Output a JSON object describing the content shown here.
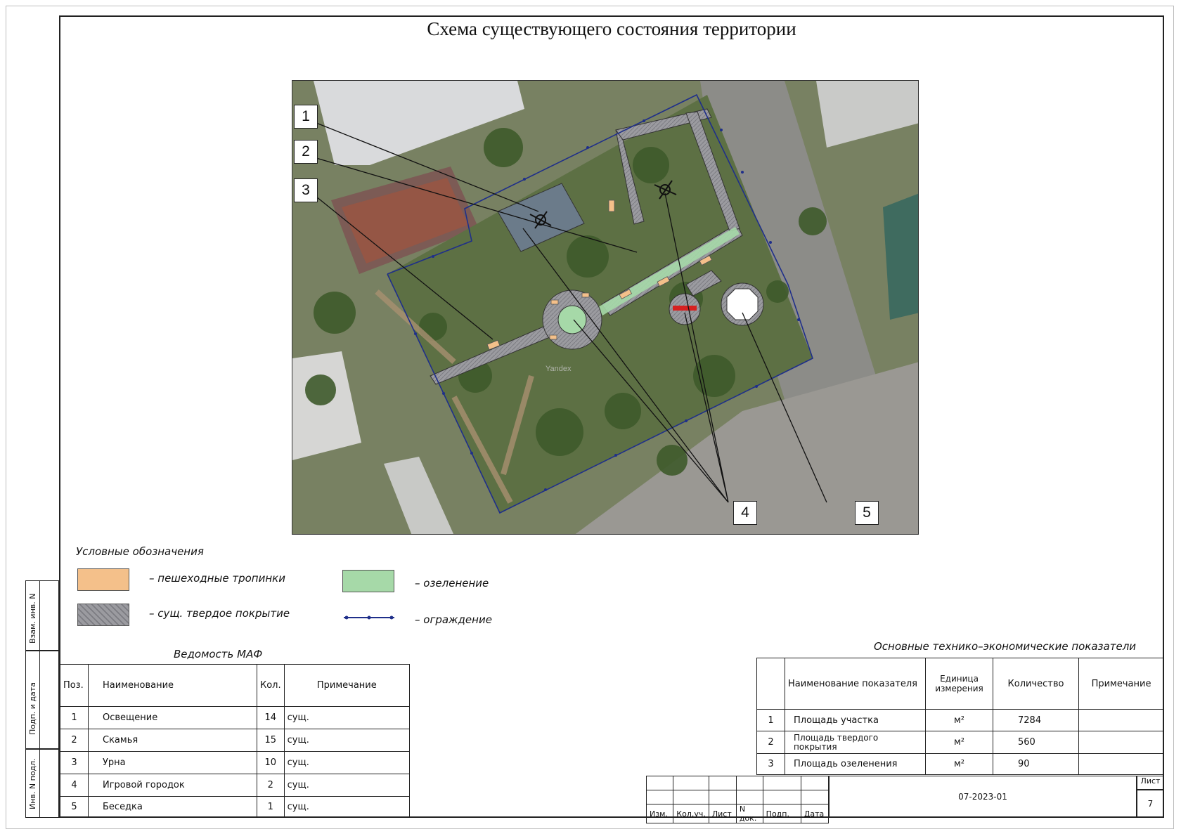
{
  "title": "Схема существующего состояния территории",
  "map": {
    "watermark": "Yandex",
    "callouts": [
      "1",
      "2",
      "3",
      "4",
      "5"
    ]
  },
  "legend": {
    "title": "Условные обозначения",
    "items": [
      {
        "label": "– пешеходные тропинки",
        "color": "#f4c08a"
      },
      {
        "label": "– сущ. твердое покрытие",
        "color": "#9a9a9f"
      },
      {
        "label": "– озеленение",
        "color": "#a6d9a8"
      },
      {
        "label": "– ограждение",
        "color": "#1f2f8a"
      }
    ]
  },
  "maf": {
    "title": "Ведомость МАФ",
    "headers": [
      "Поз.",
      "Наименование",
      "Кол.",
      "Примечание"
    ],
    "rows": [
      [
        "1",
        "Освещение",
        "14",
        "сущ."
      ],
      [
        "2",
        "Скамья",
        "15",
        "сущ."
      ],
      [
        "3",
        "Урна",
        "10",
        "сущ."
      ],
      [
        "4",
        "Игровой городок",
        "2",
        "сущ."
      ],
      [
        "5",
        "Беседка",
        "1",
        "сущ."
      ]
    ]
  },
  "tep": {
    "title": "Основные технико–экономические показатели",
    "headers": [
      "",
      "Наименование показателя",
      "Единица измерения",
      "Количество",
      "Примечание"
    ],
    "rows": [
      [
        "1",
        "Площадь участка",
        "м²",
        "7284",
        ""
      ],
      [
        "2",
        "Площадь твердого покрытия",
        "м²",
        "560",
        ""
      ],
      [
        "3",
        "Площадь озеленения",
        "м²",
        "90",
        ""
      ]
    ]
  },
  "stamp": {
    "headers": [
      "Изм.",
      "Кол.уч.",
      "Лист",
      "N док.",
      "Подп.",
      "Дата"
    ],
    "code": "07-2023-01",
    "sheet_label": "Лист",
    "sheet_number": "7"
  },
  "side": {
    "labels": [
      "Взам. инв. N",
      "Подп. и дата",
      "Инв. N подл."
    ]
  }
}
